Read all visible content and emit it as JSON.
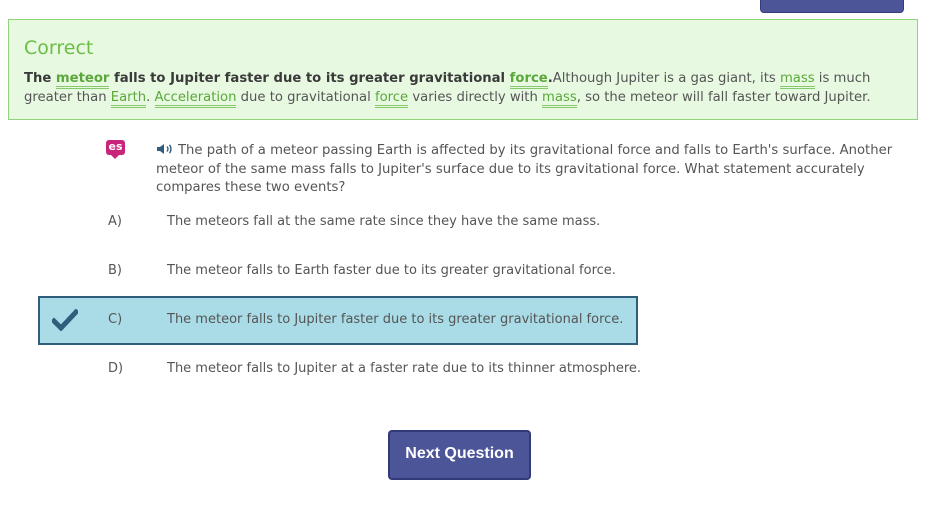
{
  "feedback": {
    "title": "Correct",
    "answer_parts": [
      "The ",
      "meteor",
      " falls to Jupiter faster due to its greater gravitational ",
      "force",
      "."
    ],
    "explanation_parts": [
      "Although Jupiter is a gas giant, its ",
      "mass",
      " is much greater than ",
      "Earth",
      ". ",
      "Acceleration",
      " due to gravitational ",
      "force",
      " varies directly with ",
      "mass",
      ", so the meteor will fall faster toward Jupiter."
    ]
  },
  "badges": {
    "spanish": "es"
  },
  "question": {
    "text": "The path of a meteor passing Earth is affected by its gravitational force and falls to Earth's surface. Another meteor of the same mass falls to Jupiter's surface due to its gravitational force. What statement accurately compares these two events?"
  },
  "choices": [
    {
      "letter": "A)",
      "text": "The meteors fall at the same rate since they have the same mass."
    },
    {
      "letter": "B)",
      "text": "The meteor falls to Earth faster due to its greater gravitational force."
    },
    {
      "letter": "C)",
      "text": "The meteor falls to Jupiter faster due to its greater gravitational force.",
      "selected": true
    },
    {
      "letter": "D)",
      "text": "The meteor falls to Jupiter at a faster rate due to its thinner atmosphere."
    }
  ],
  "buttons": {
    "next": "Next Question"
  },
  "icons": {
    "speaker": "speaker-icon",
    "check": "checkmark-icon"
  },
  "colors": {
    "correct_green": "#6cbd45",
    "button_blue": "#4c5598",
    "selected_bg": "#a9dce6",
    "selected_border": "#2f5e7d"
  }
}
